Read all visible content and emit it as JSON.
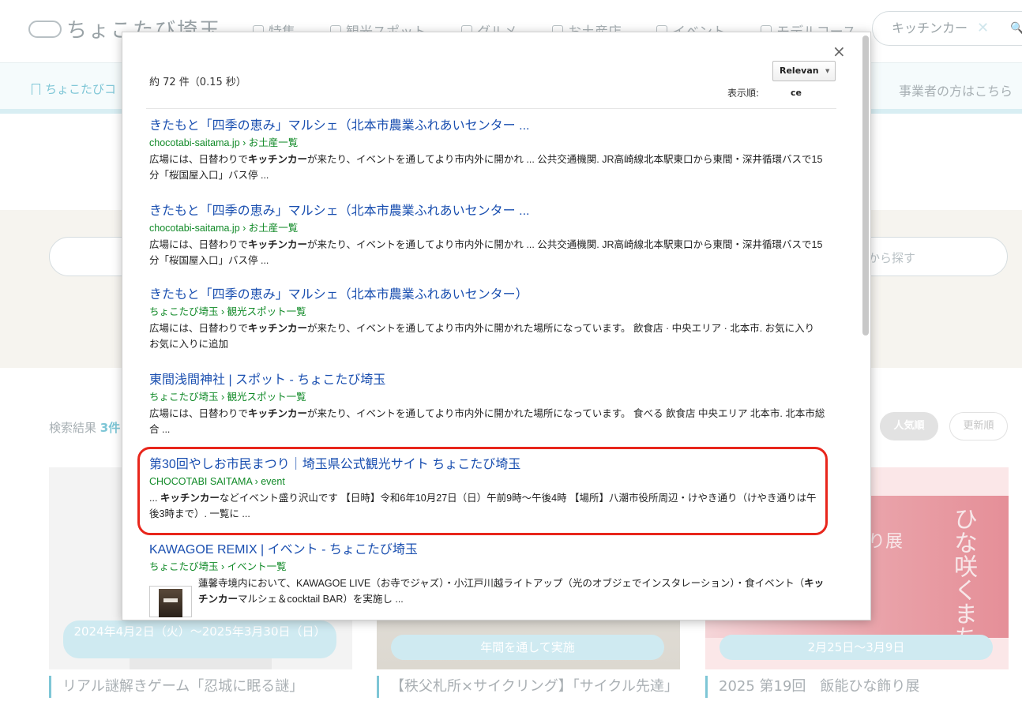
{
  "background": {
    "logo": "ちょこたび埼玉",
    "nav": [
      "特集",
      "観光スポット",
      "グルメ",
      "お土産店",
      "イベント",
      "モデルコース"
    ],
    "search_value": "キッチンカー",
    "subbar_left": "ちょこたびコ",
    "subbar_right": "事業者の方はこちら",
    "hero_search_hint": "から探す",
    "results_label": "検索結果 ",
    "results_num": "3件",
    "sort_popular": "人気順",
    "sort_updated": "更新順",
    "cards": [
      {
        "date": "2024年4月2日（火）〜2025年3月30日（日）",
        "title": "リアル謎解きゲーム「忍城に眠る謎」"
      },
      {
        "date": "年間を通して実施",
        "title": "【秩父札所×サイクリング】「サイクル先達」"
      },
      {
        "date": "2月25日〜3月9日",
        "title": "2025 第19回　飯能ひな飾り展",
        "image_text_1": "ひな咲くまち",
        "image_text_2": "り展"
      }
    ]
  },
  "modal": {
    "stats": "約 72 件（0.15 秒）",
    "sort_label": "表示順:",
    "sort_value": "Relevan",
    "sort_value_overflow": "ce",
    "close": "×",
    "results": [
      {
        "title": "きたもと「四季の恵み」マルシェ（北本市農業ふれあいセンター ...",
        "url": "chocotabi-saitama.jp › お土産一覧",
        "snippet_pre": "広場には、日替わりで",
        "snippet_bold": "キッチンカー",
        "snippet_post": "が来たり、イベントを通してより市内外に開かれ ... 公共交通機関. JR高崎線北本駅東口から東間・深井循環バスで15分「桜国屋入口」バス停 ..."
      },
      {
        "title": "きたもと「四季の恵み」マルシェ（北本市農業ふれあいセンター ...",
        "url": "chocotabi-saitama.jp › お土産一覧",
        "snippet_pre": "広場には、日替わりで",
        "snippet_bold": "キッチンカー",
        "snippet_post": "が来たり、イベントを通してより市内外に開かれ ... 公共交通機関. JR高崎線北本駅東口から東間・深井循環バスで15分「桜国屋入口」バス停 ..."
      },
      {
        "title": "きたもと「四季の恵み」マルシェ（北本市農業ふれあいセンター）",
        "url": "ちょこたび埼玉 › 観光スポット一覧",
        "snippet_pre": "広場には、日替わりで",
        "snippet_bold": "キッチンカー",
        "snippet_post": "が来たり、イベントを通してより市内外に開かれた場所になっています。 飲食店 · 中央エリア · 北本市. お気に入り お気に入りに追加"
      },
      {
        "title": "東間浅間神社 | スポット - ちょこたび埼玉",
        "url": "ちょこたび埼玉 › 観光スポット一覧",
        "snippet_pre": "広場には、日替わりで",
        "snippet_bold": "キッチンカー",
        "snippet_post": "が来たり、イベントを通してより市内外に開かれた場所になっています。 食べる 飲食店 中央エリア 北本市. 北本市総合 ..."
      },
      {
        "title": "第30回やしお市民まつり｜埼玉県公式観光サイト ちょこたび埼玉",
        "url": "CHOCOTABI SAITAMA › event",
        "snippet_pre": "... ",
        "snippet_bold": "キッチンカー",
        "snippet_post": "などイベント盛り沢山です 【日時】令和6年10月27日（日）午前9時〜午後4時 【場所】八潮市役所周辺・けやき通り（けやき通りは午後3時まで）. 一覧に ..."
      },
      {
        "title": "KAWAGOE REMIX | イベント - ちょこたび埼玉",
        "url": "ちょこたび埼玉 › イベント一覧",
        "snippet_pre": "蓮馨寺境内において、KAWAGOE LIVE（お寺でジャズ）・小江戸川越ライトアップ（光のオブジェでインスタレーション）・食イベント（",
        "snippet_bold": "キッチンカー",
        "snippet_post": "マルシェ＆cocktail BAR）を実施し ..."
      }
    ]
  },
  "colors": {
    "link": "#1a4fb0",
    "url": "#118a28",
    "highlight": "#e8261c",
    "accent": "#7ec6d6"
  }
}
